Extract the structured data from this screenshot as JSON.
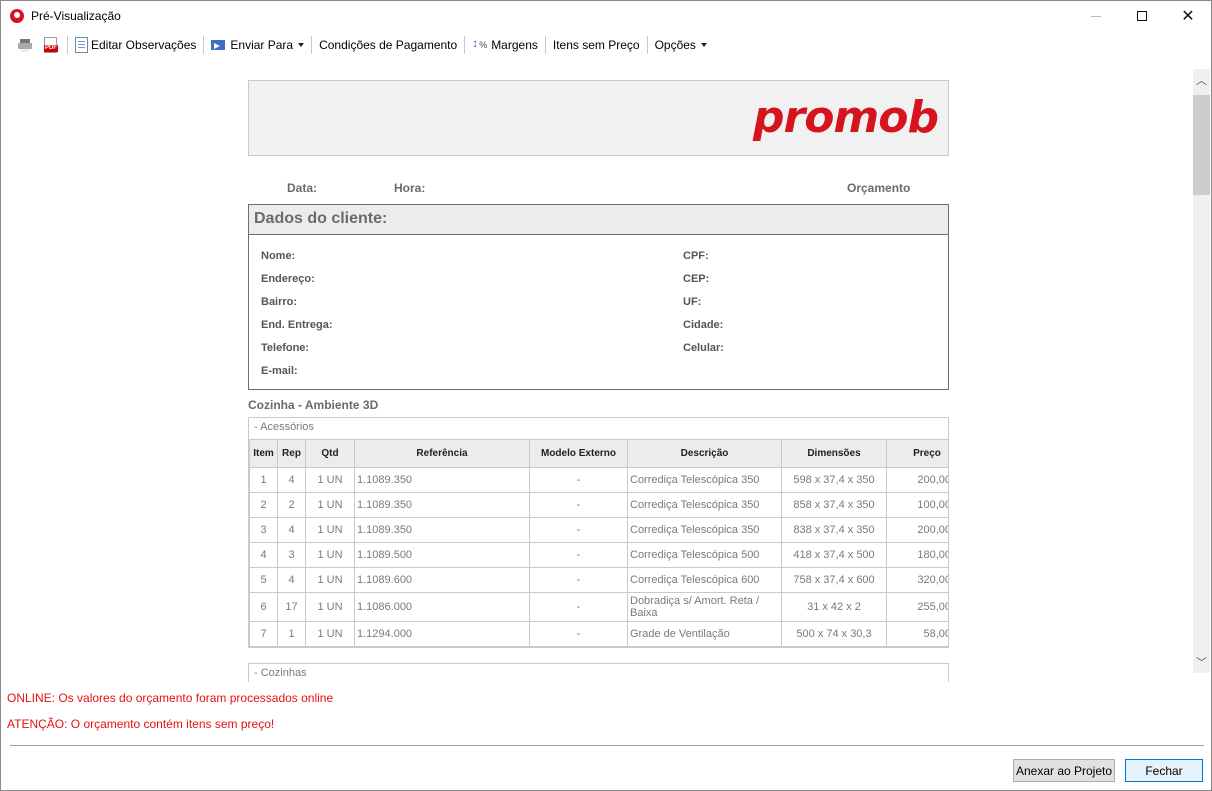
{
  "window": {
    "title": "Pré-Visualização"
  },
  "toolbar": {
    "edit_notes": "Editar Observações",
    "send_to": "Enviar Para",
    "payment_terms": "Condições de Pagamento",
    "margins": "Margens",
    "items_no_price": "Itens sem Preço",
    "options": "Opções"
  },
  "document": {
    "logo": "promob",
    "meta": {
      "date_label": "Data:",
      "time_label": "Hora:",
      "budget_label": "Orçamento"
    },
    "client": {
      "title": "Dados do cliente:",
      "left_fields": [
        "Nome:",
        "Endereço:",
        "Bairro:",
        "End. Entrega:",
        "Telefone:",
        "E-mail:"
      ],
      "right_fields": [
        "CPF:",
        "CEP:",
        "UF:",
        "Cidade:",
        "Celular:"
      ]
    },
    "environment": "Cozinha - Ambiente 3D",
    "groups": [
      {
        "label": "- Acessórios",
        "columns": [
          "Item",
          "Rep",
          "Qtd",
          "Referência",
          "Modelo Externo",
          "Descrição",
          "Dimensões",
          "Preço"
        ],
        "rows": [
          [
            "1",
            "4",
            "1 UN",
            "1.1089.350",
            "-",
            "Corrediça Telescópica 350",
            "598 x 37,4 x 350",
            "200,00"
          ],
          [
            "2",
            "2",
            "1 UN",
            "1.1089.350",
            "-",
            "Corrediça Telescópica 350",
            "858 x 37,4 x 350",
            "100,00"
          ],
          [
            "3",
            "4",
            "1 UN",
            "1.1089.350",
            "-",
            "Corrediça Telescópica 350",
            "838 x 37,4 x 350",
            "200,00"
          ],
          [
            "4",
            "3",
            "1 UN",
            "1.1089.500",
            "-",
            "Corrediça Telescópica 500",
            "418 x 37,4 x 500",
            "180,00"
          ],
          [
            "5",
            "4",
            "1 UN",
            "1.1089.600",
            "-",
            "Corrediça Telescópica 600",
            "758 x 37,4 x 600",
            "320,00"
          ],
          [
            "6",
            "17",
            "1 UN",
            "1.1086.000",
            "-",
            "Dobradiça s/ Amort. Reta / Baixa",
            "31 x 42 x 2",
            "255,00"
          ],
          [
            "7",
            "1",
            "1 UN",
            "1.1294.000",
            "-",
            "Grade de Ventilação",
            "500 x 74 x 30,3",
            "58,00"
          ]
        ]
      },
      {
        "label": "- Cozinhas"
      }
    ]
  },
  "messages": {
    "online": "ONLINE: Os valores do orçamento foram processados online",
    "warning": "ATENÇÃO: O orçamento contém itens sem preço!"
  },
  "buttons": {
    "attach": "Anexar ao Projeto",
    "close": "Fechar"
  },
  "colors": {
    "brand": "#d6141f",
    "warning": "#e81010",
    "accent": "#0078d7"
  }
}
